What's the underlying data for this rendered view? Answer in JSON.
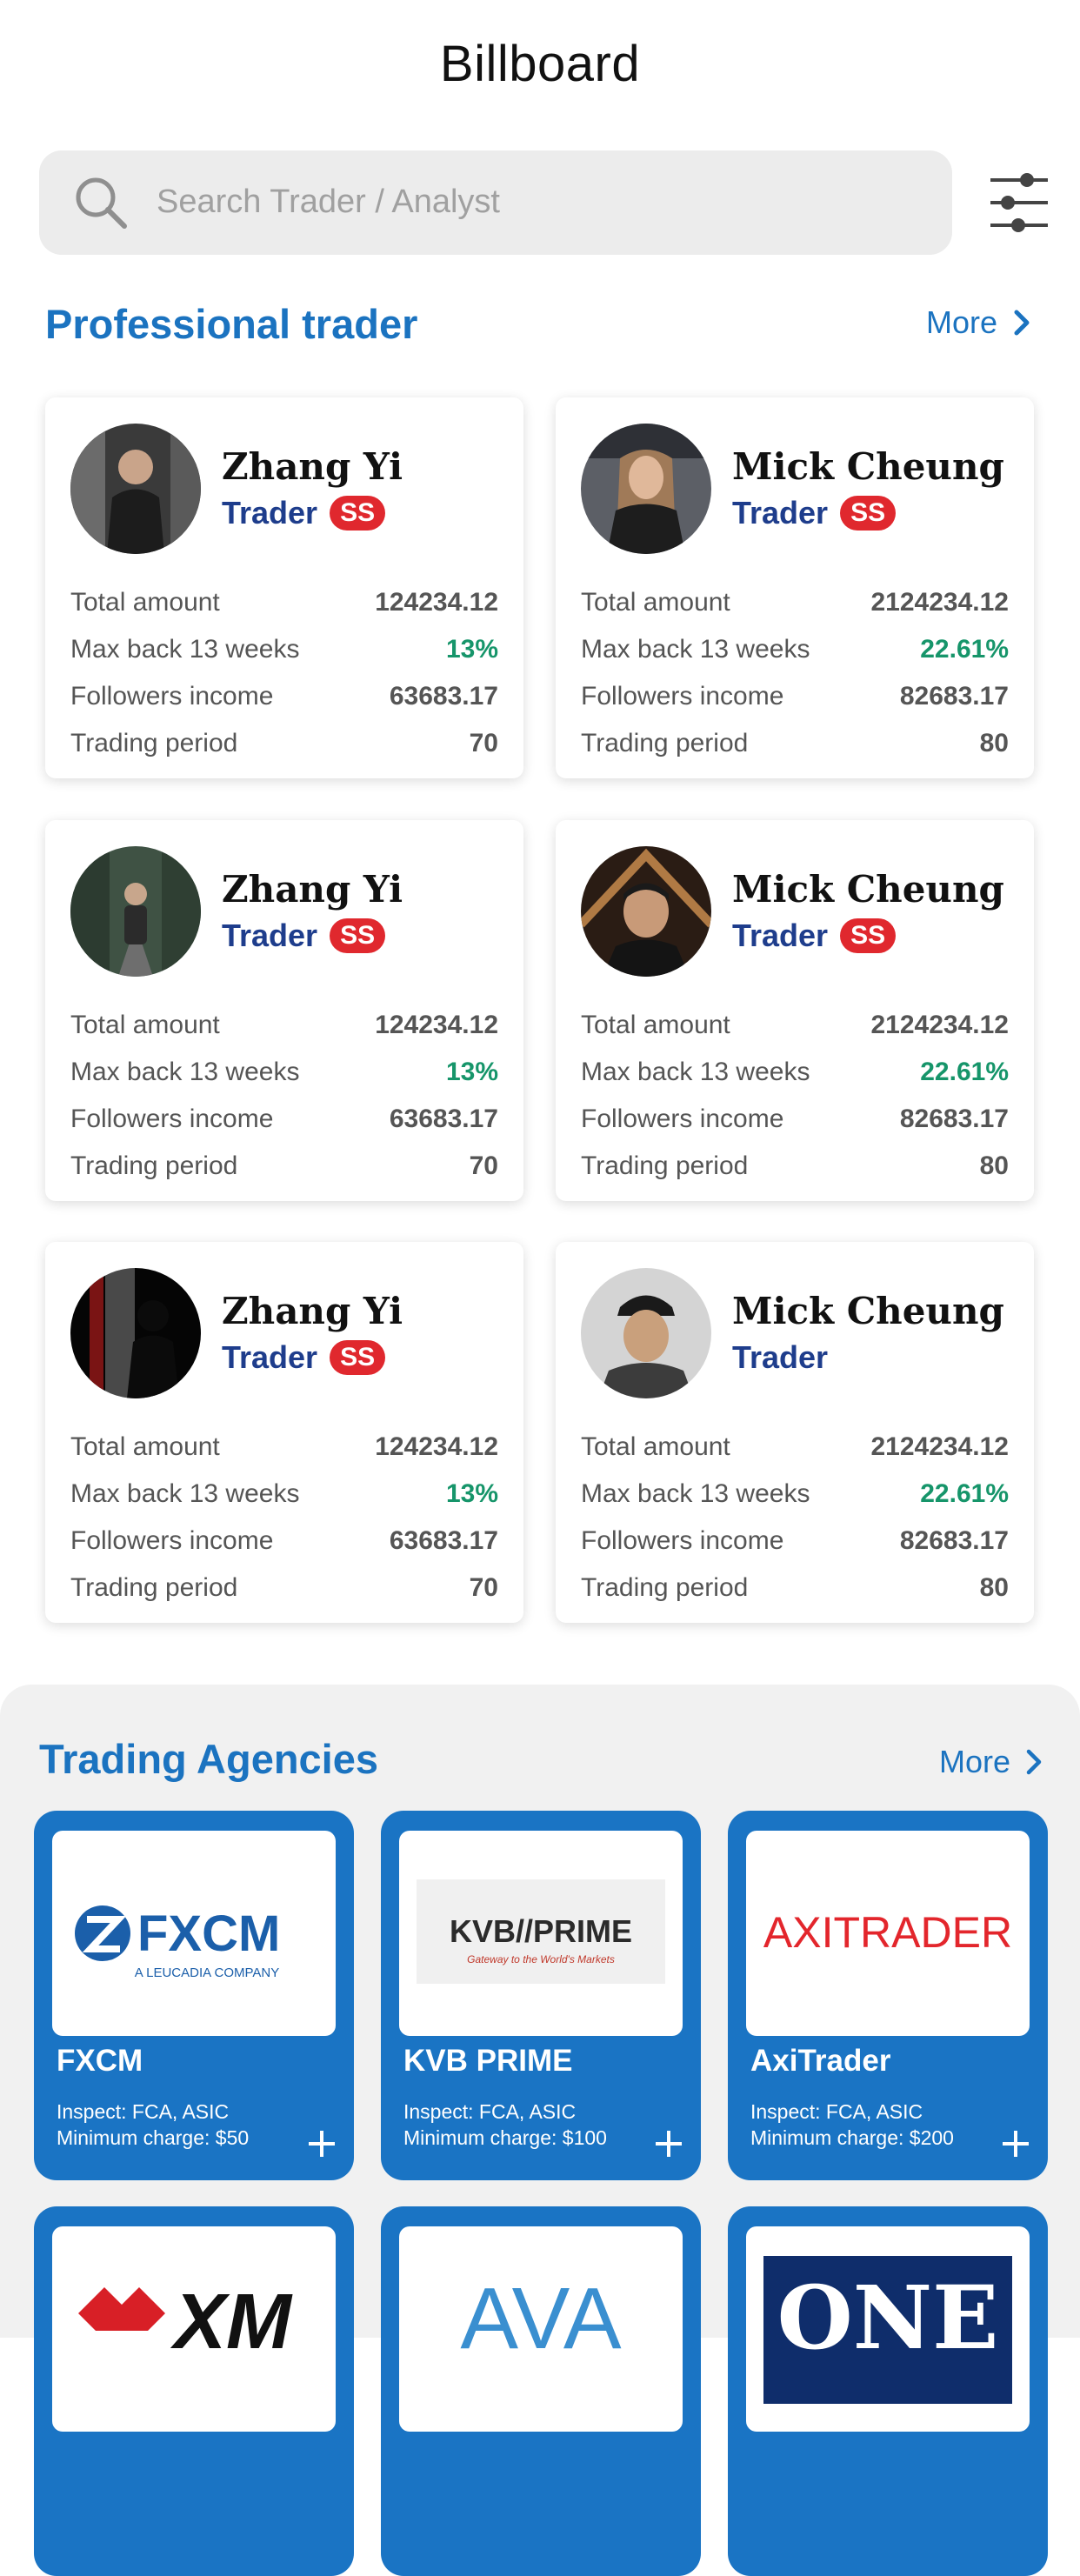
{
  "header": {
    "title": "Billboard"
  },
  "search": {
    "placeholder": "Search Trader / Analyst"
  },
  "professional": {
    "title": "Professional trader",
    "more_label": "More",
    "traders": [
      {
        "name": "Zhang Yi",
        "role": "Trader",
        "badge": "SS",
        "stats": [
          {
            "label": "Total amount",
            "value": "124234.12"
          },
          {
            "label": "Max back 13 weeks",
            "value": "13%"
          },
          {
            "label": "Followers income",
            "value": "63683.17"
          },
          {
            "label": "Trading period",
            "value": "70"
          }
        ]
      },
      {
        "name": "Mick Cheung",
        "role": "Trader",
        "badge": "SS",
        "stats": [
          {
            "label": "Total amount",
            "value": "2124234.12"
          },
          {
            "label": "Max back 13 weeks",
            "value": "22.61%"
          },
          {
            "label": "Followers income",
            "value": "82683.17"
          },
          {
            "label": "Trading period",
            "value": "80"
          }
        ]
      },
      {
        "name": "Zhang Yi",
        "role": "Trader",
        "badge": "SS",
        "stats": [
          {
            "label": "Total amount",
            "value": "124234.12"
          },
          {
            "label": "Max back 13 weeks",
            "value": "13%"
          },
          {
            "label": "Followers income",
            "value": "63683.17"
          },
          {
            "label": "Trading period",
            "value": "70"
          }
        ]
      },
      {
        "name": "Mick Cheung",
        "role": "Trader",
        "badge": "SS",
        "stats": [
          {
            "label": "Total amount",
            "value": "2124234.12"
          },
          {
            "label": "Max back 13 weeks",
            "value": "22.61%"
          },
          {
            "label": "Followers income",
            "value": "82683.17"
          },
          {
            "label": "Trading period",
            "value": "80"
          }
        ]
      },
      {
        "name": "Zhang Yi",
        "role": "Trader",
        "badge": "SS",
        "stats": [
          {
            "label": "Total amount",
            "value": "124234.12"
          },
          {
            "label": "Max back 13 weeks",
            "value": "13%"
          },
          {
            "label": "Followers income",
            "value": "63683.17"
          },
          {
            "label": "Trading period",
            "value": "70"
          }
        ]
      },
      {
        "name": "Mick Cheung",
        "role": "Trader",
        "stats": [
          {
            "label": "Total amount",
            "value": "2124234.12"
          },
          {
            "label": "Max back 13 weeks",
            "value": "22.61%"
          },
          {
            "label": "Followers income",
            "value": "82683.17"
          },
          {
            "label": "Trading period",
            "value": "80"
          }
        ]
      }
    ]
  },
  "agencies": {
    "title": "Trading Agencies",
    "more_label": "More",
    "items": [
      {
        "name": "FXCM",
        "logo_text": "FXCM",
        "logo_sub": "A LEUCADIA COMPANY",
        "inspect": "Inspect: FCA, ASIC",
        "min_charge": "Minimum charge: $50"
      },
      {
        "name": "KVB PRIME",
        "logo_text": "KVB//PRIME",
        "logo_sub": "Gateway to the World's Markets",
        "inspect": "Inspect: FCA, ASIC",
        "min_charge": "Minimum charge: $100"
      },
      {
        "name": "AxiTrader",
        "logo_text": "AXITRADER",
        "inspect": "Inspect: FCA, ASIC",
        "min_charge": "Minimum charge: $200"
      },
      {
        "logo_text": "XM"
      },
      {
        "logo_text": "AVA"
      },
      {
        "logo_text": "ONE"
      }
    ]
  },
  "colors": {
    "accent": "#1b73c0",
    "badge": "#e0282e",
    "positive": "#16956a",
    "role": "#1e3d8c"
  }
}
